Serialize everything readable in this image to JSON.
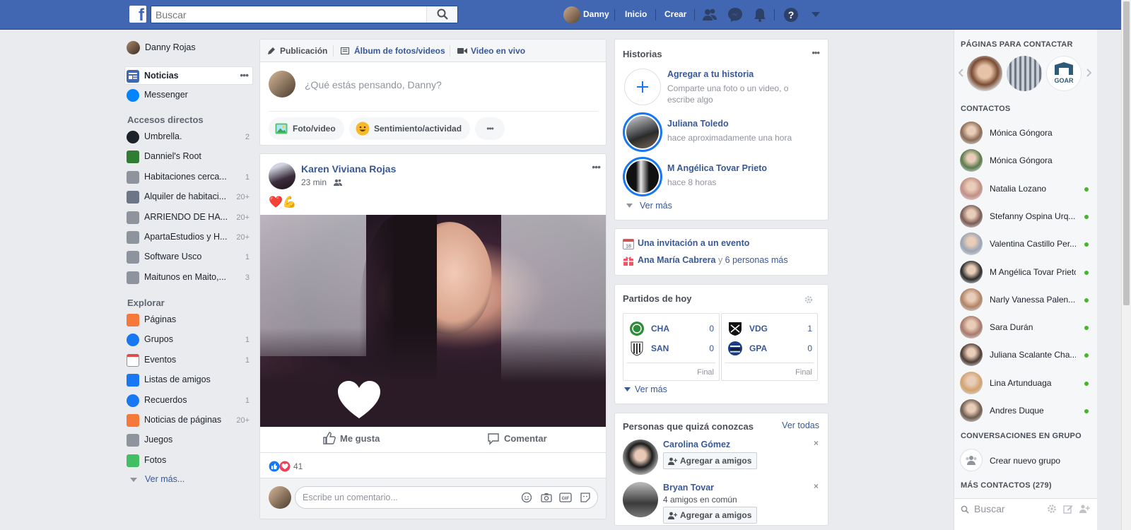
{
  "topbar": {
    "logo": "f",
    "search_placeholder": "Buscar",
    "user_name": "Danny",
    "home_label": "Inicio",
    "create_label": "Crear"
  },
  "left": {
    "profile_name": "Danny Rojas",
    "main": [
      {
        "label": "Noticias",
        "icon": "news-feed-icon"
      },
      {
        "label": "Messenger",
        "icon": "messenger-icon"
      }
    ],
    "shortcuts_title": "Accesos directos",
    "shortcuts": [
      {
        "label": "Umbrella. ",
        "count": "2",
        "icon": "umbrella-icon"
      },
      {
        "label": "Danniel's Root",
        "count": "",
        "icon": "chip-icon"
      },
      {
        "label": "Habitaciones cerca...",
        "count": "1",
        "icon": "group-icon"
      },
      {
        "label": "Alquiler de habitaci...",
        "count": "20+",
        "icon": "shield-icon"
      },
      {
        "label": "ARRIENDO DE HA...",
        "count": "20+",
        "icon": "group-icon"
      },
      {
        "label": "ApartaEstudios y H...",
        "count": "20+",
        "icon": "group-icon"
      },
      {
        "label": "Software Usco",
        "count": "1",
        "icon": "group-icon"
      },
      {
        "label": "Maitunos en Maito,...",
        "count": "3",
        "icon": "group-icon"
      }
    ],
    "explore_title": "Explorar",
    "explore": [
      {
        "label": "Páginas",
        "count": "",
        "icon": "flag-icon"
      },
      {
        "label": "Grupos",
        "count": "1",
        "icon": "groups-icon"
      },
      {
        "label": "Eventos",
        "count": "1",
        "icon": "calendar-icon"
      },
      {
        "label": "Listas de amigos",
        "count": "",
        "icon": "friends-list-icon"
      },
      {
        "label": "Recuerdos",
        "count": "1",
        "icon": "memories-icon"
      },
      {
        "label": "Noticias de páginas",
        "count": "20+",
        "icon": "pages-feed-icon"
      },
      {
        "label": "Juegos",
        "count": "",
        "icon": "gamepad-icon"
      },
      {
        "label": "Fotos",
        "count": "",
        "icon": "photos-icon"
      }
    ],
    "see_more": "Ver más..."
  },
  "composer": {
    "tabs": [
      "Publicación",
      "Álbum de fotos/videos",
      "Video en vivo"
    ],
    "placeholder": "¿Qué estás pensando, Danny?",
    "actions": [
      "Foto/video",
      "Sentimiento/actividad"
    ]
  },
  "post": {
    "author": "Karen Viviana Rojas",
    "time": "23 min",
    "text_emojis": "❤️💪",
    "like_label": "Me gusta",
    "comment_label": "Comentar",
    "reactions_count": "41",
    "comment_placeholder": "Escribe un comentario..."
  },
  "stories": {
    "title": "Historias",
    "add_title": "Agregar a tu historia",
    "add_sub": "Comparte una foto o un video, o escribe algo",
    "items": [
      {
        "name": "Juliana Toledo",
        "time": "hace aproximadamente una hora"
      },
      {
        "name": "M Angélica Tovar Prieto",
        "time": "hace 8 horas"
      }
    ],
    "see_more": "Ver más"
  },
  "events": {
    "invite": "Una invitación a un evento",
    "birthday_name": "Ana María Cabrera",
    "birthday_mid": " y ",
    "birthday_rest": "6 personas más",
    "calendar_day": "18"
  },
  "matches": {
    "title": "Partidos de hoy",
    "games": [
      {
        "team1": "CHA",
        "score1": "0",
        "team2": "SAN",
        "score2": "0",
        "status": "Final"
      },
      {
        "team1": "VDG",
        "score1": "1",
        "team2": "GPA",
        "score2": "0",
        "status": "Final"
      }
    ],
    "see_more": "Ver más"
  },
  "pymk": {
    "title": "Personas que quizá conozcas",
    "see_all": "Ver todas",
    "people": [
      {
        "name": "Carolina Gómez",
        "sub": "",
        "button": "Agregar a amigos"
      },
      {
        "name": "Bryan Tovar",
        "sub": "4 amigos en común",
        "button": "Agregar a amigos"
      }
    ]
  },
  "sidebar": {
    "pages_title": "PÁGINAS PARA CONTACTAR",
    "page_logo_text": "GOAR",
    "contacts_title": "CONTACTOS",
    "contacts": [
      {
        "name": "Mónica Góngora",
        "online": false
      },
      {
        "name": "Mónica Góngora",
        "online": false
      },
      {
        "name": "Natalia Lozano",
        "online": true
      },
      {
        "name": "Stefanny Ospina Urq...",
        "online": true
      },
      {
        "name": "Valentina Castillo Per...",
        "online": true
      },
      {
        "name": "M Angélica Tovar Prieto",
        "online": true
      },
      {
        "name": "Narly Vanessa Palen...",
        "online": true
      },
      {
        "name": "Sara Durán",
        "online": true
      },
      {
        "name": "Juliana Scalante Cha...",
        "online": true
      },
      {
        "name": "Lina Artunduaga",
        "online": true
      },
      {
        "name": "Andres Duque",
        "online": true
      }
    ],
    "group_title": "CONVERSACIONES EN GRUPO",
    "new_group": "Crear nuevo grupo",
    "more_contacts": "MÁS CONTACTOS (279)",
    "search_placeholder": "Buscar"
  },
  "colors": {
    "brand": "#4267b2",
    "link": "#385898",
    "online": "#42b72a",
    "background": "#e9ebee"
  }
}
